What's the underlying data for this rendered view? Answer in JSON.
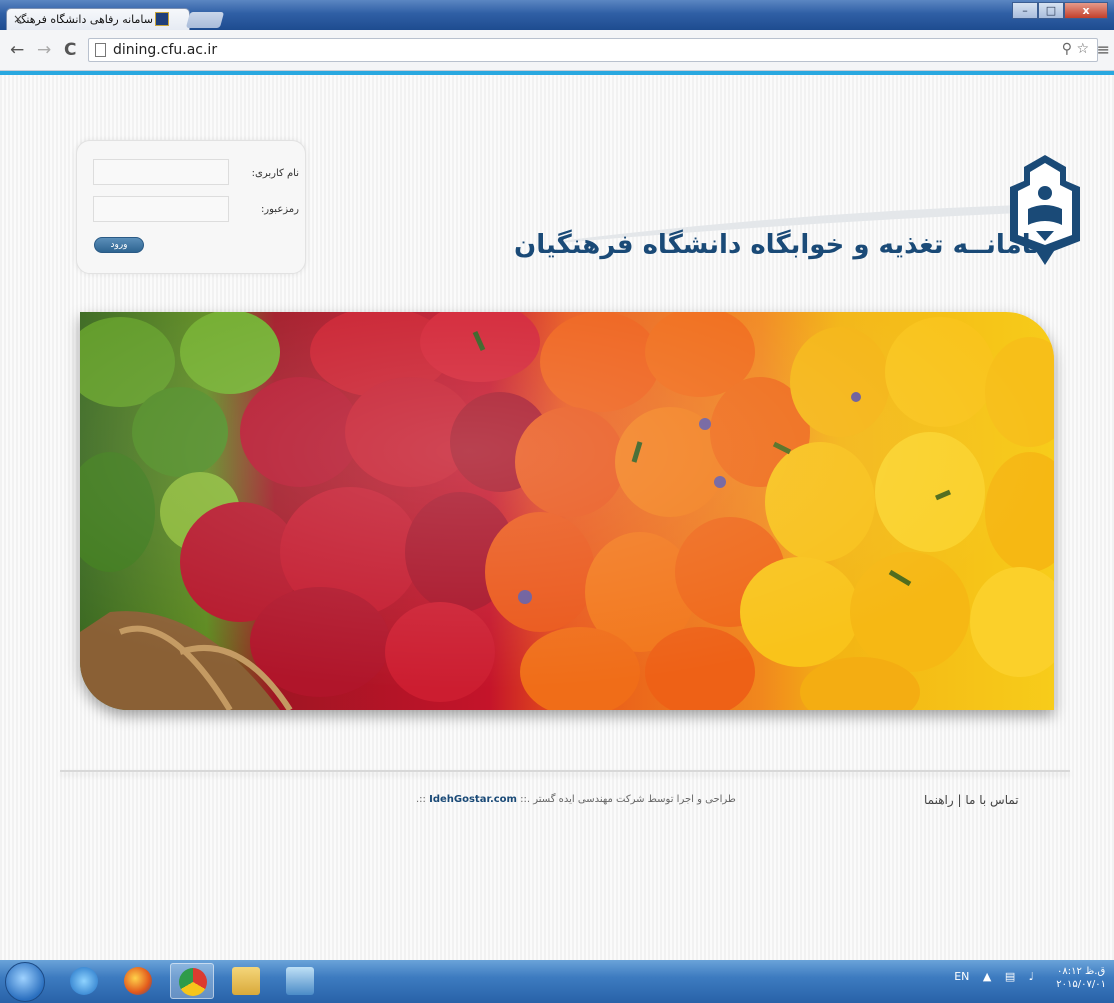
{
  "browser": {
    "tab_title": "سامانه رفاهی دانشگاه فرهنگ",
    "tab_close": "×",
    "url": "dining.cfu.ac.ir",
    "nav_back": "←",
    "nav_forward": "→",
    "nav_reload": "C",
    "zoom_icon": "zoom-icon",
    "star_icon": "star-icon",
    "menu_icon": "menu-icon",
    "win_min": "–",
    "win_max": "□",
    "win_close": "x"
  },
  "login": {
    "username_label": "نام کاربری:",
    "password_label": "رمزعبور:",
    "submit_label": "ورود"
  },
  "header": {
    "site_title": "سامانــه تغذیه و خوابگاه دانشگاه فرهنگیان"
  },
  "footer": {
    "links": "تماس با ما | راهنما",
    "credit_prefix": "طراحی و اجرا توسط شرکت مهندسی ایده گستر .:: ",
    "credit_brand": "IdehGostar.com",
    "credit_suffix": " ::."
  },
  "taskbar": {
    "lang": "EN",
    "clock_line1": "ق.ظ ۰۸:۱۲",
    "clock_line2": "۲۰۱۵/۰۷/۰۱"
  },
  "colors": {
    "accent": "#29a8e0",
    "logo_blue": "#1a4a77",
    "taskbar": "#2862a8"
  }
}
